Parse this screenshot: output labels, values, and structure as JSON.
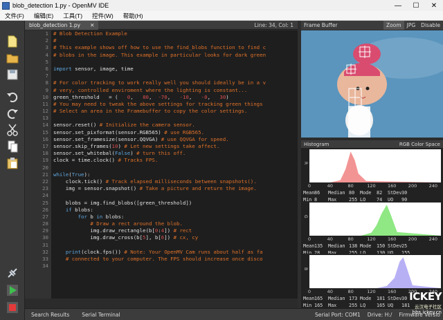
{
  "window": {
    "title": "blob_detection 1.py - OpenMV IDE",
    "min": "—",
    "max": "☐",
    "close": "✕"
  },
  "menu": [
    "文件(F)",
    "编辑(E)",
    "工具(T)",
    "控件(W)",
    "帮助(H)"
  ],
  "editor": {
    "tab": "blob_detection 1.py",
    "tab_close": "✕",
    "status": "Line: 34, Col: 1",
    "lines": [
      [
        [
          "c",
          "# Blob Detection Example"
        ]
      ],
      [
        [
          "c",
          "#"
        ]
      ],
      [
        [
          "c",
          "# This example shows off how to use the find_blobs function to find c"
        ]
      ],
      [
        [
          "c",
          "# blobs in the image. This example in particular looks for dark green"
        ]
      ],
      [],
      [
        [
          "k",
          "import"
        ],
        [
          "t",
          " sensor, image, time"
        ]
      ],
      [],
      [
        [
          "c",
          "# For color tracking to work really well you should ideally be in a v"
        ]
      ],
      [
        [
          "c",
          "# very, controlled enviroment where the lighting is constant..."
        ]
      ],
      [
        [
          "t",
          "green_threshold   = (   "
        ],
        [
          "n",
          "0"
        ],
        [
          "t",
          ",   "
        ],
        [
          "n",
          "80"
        ],
        [
          "t",
          ",  "
        ],
        [
          "n",
          "-70"
        ],
        [
          "t",
          ",   "
        ],
        [
          "n",
          "-10"
        ],
        [
          "t",
          ",   "
        ],
        [
          "n",
          "-0"
        ],
        [
          "t",
          ",   "
        ],
        [
          "n",
          "30"
        ],
        [
          "t",
          ")"
        ]
      ],
      [
        [
          "c",
          "# You may need to tweak the above settings for tracking green things"
        ]
      ],
      [
        [
          "c",
          "# Select an area in the Framebuffer to copy the color settings."
        ]
      ],
      [],
      [
        [
          "t",
          "sensor.reset() "
        ],
        [
          "c",
          "# Initialize the camera sensor."
        ]
      ],
      [
        [
          "t",
          "sensor.set_pixformat(sensor.RGB565) "
        ],
        [
          "c",
          "# use RGB565."
        ]
      ],
      [
        [
          "t",
          "sensor.set_framesize(sensor.QQVGA) "
        ],
        [
          "c",
          "# use QQVGA for speed."
        ]
      ],
      [
        [
          "t",
          "sensor.skip_frames("
        ],
        [
          "n",
          "10"
        ],
        [
          "t",
          ") "
        ],
        [
          "c",
          "# Let new settings take affect."
        ]
      ],
      [
        [
          "t",
          "sensor.set_whitebal("
        ],
        [
          "k",
          "False"
        ],
        [
          "t",
          ") "
        ],
        [
          "c",
          "# turn this off."
        ]
      ],
      [
        [
          "t",
          "clock = time.clock() "
        ],
        [
          "c",
          "# Tracks FPS."
        ]
      ],
      [],
      [
        [
          "k",
          "while"
        ],
        [
          "t",
          "("
        ],
        [
          "k",
          "True"
        ],
        [
          "t",
          "):"
        ]
      ],
      [
        [
          "t",
          "    clock.tick() "
        ],
        [
          "c",
          "# Track elapsed milliseconds between snapshots()."
        ]
      ],
      [
        [
          "t",
          "    img = sensor.snapshot() "
        ],
        [
          "c",
          "# Take a picture and return the image."
        ]
      ],
      [],
      [
        [
          "t",
          "    blobs = img.find_blobs([green_threshold])"
        ]
      ],
      [
        [
          "t",
          "    "
        ],
        [
          "k",
          "if"
        ],
        [
          "t",
          " blobs:"
        ]
      ],
      [
        [
          "t",
          "        "
        ],
        [
          "k",
          "for"
        ],
        [
          "t",
          " b "
        ],
        [
          "k",
          "in"
        ],
        [
          "t",
          " blobs:"
        ]
      ],
      [
        [
          "t",
          "            "
        ],
        [
          "c",
          "# Draw a rect around the blob."
        ]
      ],
      [
        [
          "t",
          "            img.draw_rectangle(b["
        ],
        [
          "n",
          "0"
        ],
        [
          "t",
          ":"
        ],
        [
          "n",
          "4"
        ],
        [
          "t",
          "]) "
        ],
        [
          "c",
          "# rect"
        ]
      ],
      [
        [
          "t",
          "            img.draw_cross(b["
        ],
        [
          "n",
          "5"
        ],
        [
          "t",
          "], b["
        ],
        [
          "n",
          "6"
        ],
        [
          "t",
          "]) "
        ],
        [
          "c",
          "# cx, cy"
        ]
      ],
      [],
      [
        [
          "t",
          "    "
        ],
        [
          "k",
          "print"
        ],
        [
          "t",
          "(clock.fps()) "
        ],
        [
          "c",
          "# Note: Your OpenMV Cam runs about half as fa"
        ]
      ],
      [
        [
          "t",
          "    "
        ],
        [
          "c",
          "# connected to your computer. The FPS should increase once disco"
        ]
      ],
      []
    ]
  },
  "framebuffer": {
    "label": "Frame Buffer",
    "zoom": "Zoom",
    "jpg": "JPG",
    "disable": "Disable"
  },
  "histogram": {
    "label": "Histogram",
    "space": "RGB Color Space",
    "ticks": [
      "0",
      "40",
      "80",
      "120",
      "160",
      "200",
      "240"
    ],
    "channels": [
      {
        "name": "R",
        "color": "#f39494",
        "stats": [
          "Mean",
          "86",
          "Median",
          "80",
          "Mode",
          "82",
          "StDev",
          "30",
          "Min",
          "8",
          "Max",
          "255",
          "LQ",
          "74",
          "UQ",
          "90"
        ]
      },
      {
        "name": "G",
        "color": "#8fe883",
        "stats": [
          "Mean",
          "135",
          "Median",
          "138",
          "Mode",
          "150",
          "StDev",
          "25",
          "Min",
          "28",
          "Max",
          "255",
          "LQ",
          "130",
          "UQ",
          "155"
        ]
      },
      {
        "name": "B",
        "color": "#b7b0f5",
        "stats": [
          "Mean",
          "165",
          "Median",
          "173",
          "Mode",
          "181",
          "StDev",
          "30",
          "Min",
          "165",
          "Max",
          "255",
          "LQ",
          "165",
          "UQ",
          "181"
        ]
      }
    ]
  },
  "chart_data": [
    {
      "type": "area",
      "title": "R",
      "x": [
        0,
        40,
        60,
        70,
        80,
        88,
        95,
        110,
        255
      ],
      "values": [
        0,
        0,
        3,
        18,
        42,
        30,
        12,
        2,
        0
      ],
      "xlim": [
        0,
        255
      ]
    },
    {
      "type": "area",
      "title": "G",
      "x": [
        0,
        100,
        120,
        130,
        140,
        150,
        158,
        170,
        255
      ],
      "values": [
        0,
        0,
        4,
        14,
        30,
        42,
        28,
        5,
        0
      ],
      "xlim": [
        0,
        255
      ]
    },
    {
      "type": "area",
      "title": "B",
      "x": [
        0,
        130,
        150,
        165,
        175,
        182,
        190,
        200,
        255
      ],
      "values": [
        0,
        0,
        3,
        14,
        36,
        42,
        25,
        4,
        0
      ],
      "xlim": [
        0,
        255
      ]
    }
  ],
  "bottom": {
    "search": "Search Results",
    "serial": "Serial Terminal",
    "port": "Serial Port: COM1",
    "drive": "Drive: H:/",
    "firmware": "Firmware Versio"
  },
  "watermark": {
    "brand": "ICKEY",
    "cn": "云汉电子社区",
    "url": "bbs.ickey.cn"
  }
}
